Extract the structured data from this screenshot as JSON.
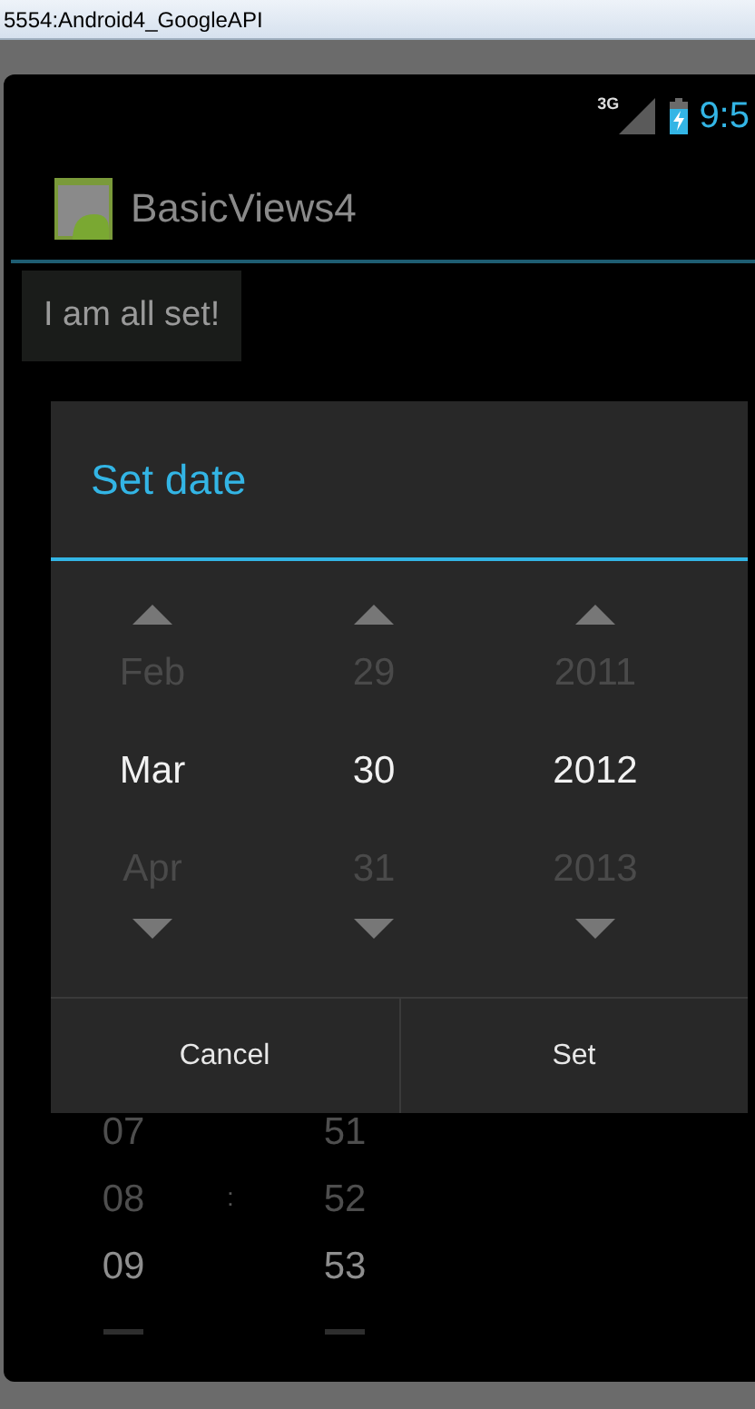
{
  "window": {
    "title": "5554:Android4_GoogleAPI"
  },
  "status_bar": {
    "network": "3G",
    "time": "9:5"
  },
  "action_bar": {
    "title": "BasicViews4"
  },
  "button": {
    "label": "I am all set!"
  },
  "time_picker": {
    "separator": ":",
    "columns": [
      {
        "items": [
          {
            "text": "07",
            "selected": false
          },
          {
            "text": "08",
            "selected": false
          },
          {
            "text": "09",
            "selected": true
          }
        ]
      },
      {
        "items": [
          {
            "text": "51",
            "selected": false
          },
          {
            "text": "52",
            "selected": false
          },
          {
            "text": "53",
            "selected": true
          }
        ]
      }
    ]
  },
  "dialog": {
    "title": "Set date",
    "columns": [
      {
        "items": [
          {
            "text": "Feb",
            "selected": false
          },
          {
            "text": "Mar",
            "selected": true
          },
          {
            "text": "Apr",
            "selected": false
          }
        ]
      },
      {
        "items": [
          {
            "text": "29",
            "selected": false
          },
          {
            "text": "30",
            "selected": true
          },
          {
            "text": "31",
            "selected": false
          }
        ]
      },
      {
        "items": [
          {
            "text": "2011",
            "selected": false
          },
          {
            "text": "2012",
            "selected": true
          },
          {
            "text": "2013",
            "selected": false
          }
        ]
      }
    ],
    "buttons": [
      {
        "label": "Cancel"
      },
      {
        "label": "Set"
      }
    ]
  }
}
